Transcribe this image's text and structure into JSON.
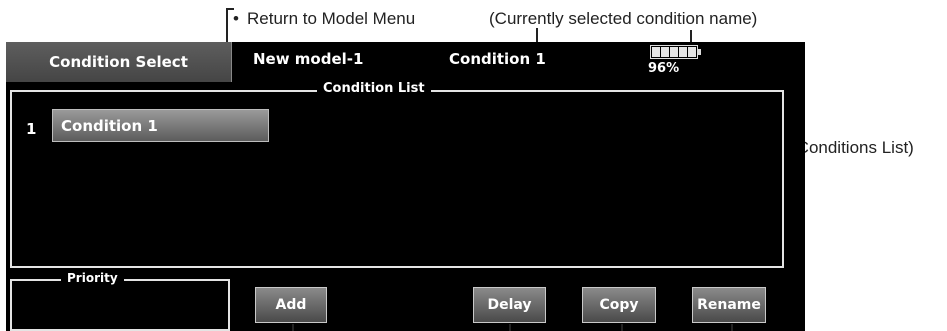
{
  "callouts": {
    "return_to_model_menu": "Return to Model Menu",
    "selected_condition_name": "(Currently selected condition name)",
    "conditions_list": "(Conditions List)"
  },
  "screen": {
    "header": {
      "tab_label": "Condition Select",
      "model_name": "New model-1",
      "condition_name": "Condition 1",
      "battery_percent": "96%",
      "battery_level": 0.96
    },
    "condition_list": {
      "title": "Condition List",
      "items": [
        {
          "number": "1",
          "label": "Condition 1"
        }
      ]
    },
    "priority": {
      "title": "Priority"
    },
    "buttons": {
      "add": "Add",
      "delay": "Delay",
      "copy": "Copy",
      "rename": "Rename"
    }
  },
  "colors": {
    "screen_bg": "#000000",
    "frame_border": "#e4e4e4",
    "button_gradient_top": "#8a8a8a",
    "button_gradient_bottom": "#4a4a4a",
    "annotation_ink": "#222222"
  }
}
